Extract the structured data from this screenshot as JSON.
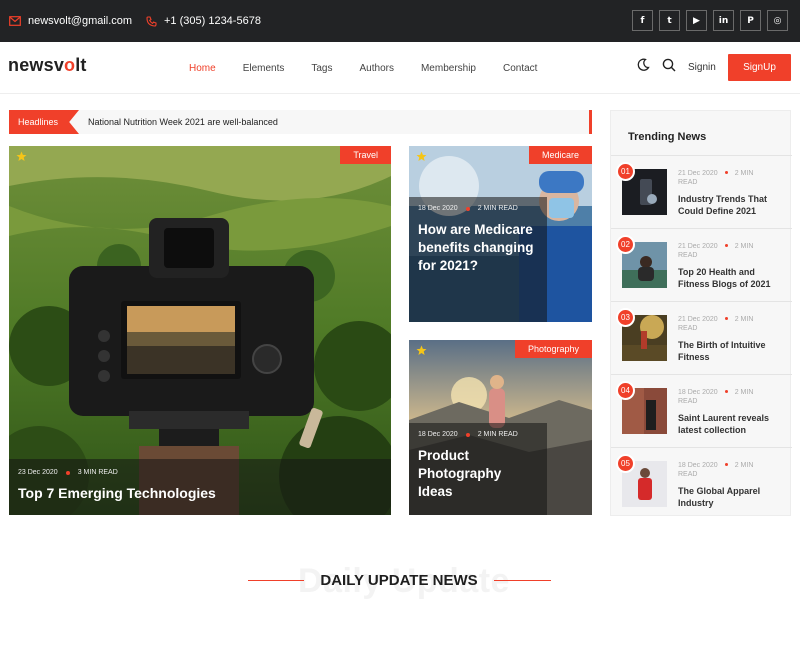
{
  "topbar": {
    "email": "newsvolt@gmail.com",
    "phone": "+1 (305) 1234-5678",
    "socials": [
      {
        "name": "facebook",
        "glyph": "f"
      },
      {
        "name": "twitter",
        "glyph": "t"
      },
      {
        "name": "youtube",
        "glyph": "▶"
      },
      {
        "name": "linkedin",
        "glyph": "in"
      },
      {
        "name": "pinterest",
        "glyph": "P"
      },
      {
        "name": "instagram",
        "glyph": "◎"
      }
    ]
  },
  "header": {
    "logo_part1": "newsv",
    "logo_part2": "o",
    "logo_part3": "lt",
    "nav": [
      "Home",
      "Elements",
      "Tags",
      "Authors",
      "Membership",
      "Contact"
    ],
    "active_nav": "Home",
    "signin": "Signin",
    "signup": "SignUp"
  },
  "ticker": {
    "label": "Headlines",
    "text": "National Nutrition Week 2021 are well-balanced"
  },
  "featured": [
    {
      "category": "Travel",
      "date": "23 Dec 2020",
      "read": "3 MIN READ",
      "title": "Top 7 Emerging Technologies"
    },
    {
      "category": "Medicare",
      "date": "18 Dec 2020",
      "read": "2 MIN READ",
      "title": "How are Medicare benefits changing for 2021?"
    },
    {
      "category": "Photography",
      "date": "18 Dec 2020",
      "read": "2 MIN READ",
      "title": "Product Photography Ideas"
    }
  ],
  "trending": {
    "title": "Trending News",
    "items": [
      {
        "num": "01",
        "date": "21 Dec 2020",
        "read": "2 MIN",
        "read2": "READ",
        "title": "Industry Trends That Could Define 2021"
      },
      {
        "num": "02",
        "date": "21 Dec 2020",
        "read": "2 MIN",
        "read2": "READ",
        "title": "Top 20 Health and Fitness Blogs of 2021"
      },
      {
        "num": "03",
        "date": "21 Dec 2020",
        "read": "2 MIN",
        "read2": "READ",
        "title": "The Birth of Intuitive Fitness"
      },
      {
        "num": "04",
        "date": "18 Dec 2020",
        "read": "2 MIN",
        "read2": "READ",
        "title": "Saint Laurent reveals latest collection"
      },
      {
        "num": "05",
        "date": "18 Dec 2020",
        "read": "2 MIN",
        "read2": "READ",
        "title": "The Global Apparel Industry"
      }
    ]
  },
  "section": {
    "title": "DAILY UPDATE NEWS",
    "background_text": "Daily Update"
  },
  "colors": {
    "accent": "#f0402a",
    "topbar": "#222325"
  }
}
